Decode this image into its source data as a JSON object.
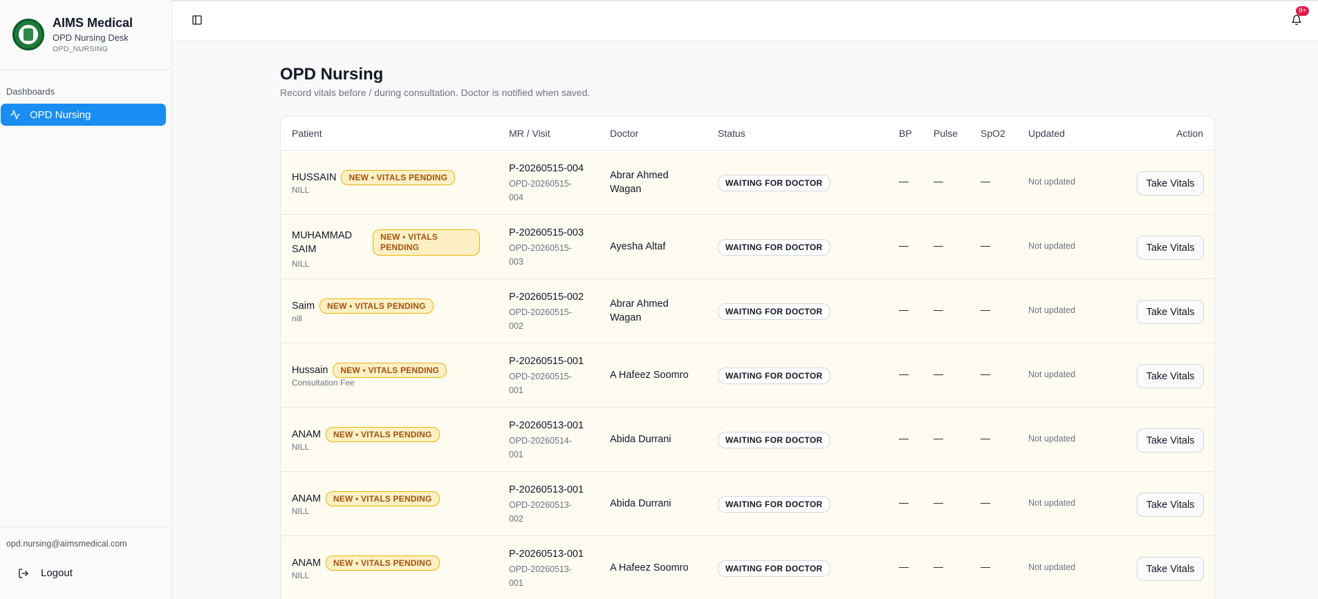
{
  "brand": {
    "title": "AIMS Medical",
    "subtitle": "OPD Nursing Desk",
    "role": "OPD_NURSING"
  },
  "sidebar": {
    "section_label": "Dashboards",
    "items": [
      {
        "label": "OPD Nursing",
        "icon": "activity-icon",
        "active": true
      }
    ],
    "user_email": "opd.nursing@aimsmedical.com",
    "logout_label": "Logout"
  },
  "topbar": {
    "notification_badge": "9+"
  },
  "page": {
    "title": "OPD Nursing",
    "description": "Record vitals before / during consultation. Doctor is notified when saved."
  },
  "table": {
    "headers": {
      "patient": "Patient",
      "mr_visit": "MR / Visit",
      "doctor": "Doctor",
      "status": "Status",
      "bp": "BP",
      "pulse": "Pulse",
      "spo2": "SpO2",
      "updated": "Updated",
      "action": "Action"
    },
    "rows": [
      {
        "name": "HUSSAIN",
        "badge": "NEW • VITALS PENDING",
        "note": "NILL",
        "mr": "P-20260515-004",
        "visit": "OPD-20260515-004",
        "doctor": "Abrar Ahmed Wagan",
        "status": "WAITING FOR DOCTOR",
        "bp": "—",
        "pulse": "—",
        "spo2": "—",
        "updated": "Not updated",
        "action": "Take Vitals"
      },
      {
        "name": "MUHAMMAD SAIM",
        "badge": "NEW • VITALS PENDING",
        "note": "NILL",
        "mr": "P-20260515-003",
        "visit": "OPD-20260515-003",
        "doctor": "Ayesha Altaf",
        "status": "WAITING FOR DOCTOR",
        "bp": "—",
        "pulse": "—",
        "spo2": "—",
        "updated": "Not updated",
        "action": "Take Vitals"
      },
      {
        "name": "Saim",
        "badge": "NEW • VITALS PENDING",
        "note": "nill",
        "mr": "P-20260515-002",
        "visit": "OPD-20260515-002",
        "doctor": "Abrar Ahmed Wagan",
        "status": "WAITING FOR DOCTOR",
        "bp": "—",
        "pulse": "—",
        "spo2": "—",
        "updated": "Not updated",
        "action": "Take Vitals"
      },
      {
        "name": "Hussain",
        "badge": "NEW • VITALS PENDING",
        "note": "Consultation Fee",
        "mr": "P-20260515-001",
        "visit": "OPD-20260515-001",
        "doctor": "A Hafeez Soomro",
        "status": "WAITING FOR DOCTOR",
        "bp": "—",
        "pulse": "—",
        "spo2": "—",
        "updated": "Not updated",
        "action": "Take Vitals"
      },
      {
        "name": "ANAM",
        "badge": "NEW • VITALS PENDING",
        "note": "NILL",
        "mr": "P-20260513-001",
        "visit": "OPD-20260514-001",
        "doctor": "Abida Durrani",
        "status": "WAITING FOR DOCTOR",
        "bp": "—",
        "pulse": "—",
        "spo2": "—",
        "updated": "Not updated",
        "action": "Take Vitals"
      },
      {
        "name": "ANAM",
        "badge": "NEW • VITALS PENDING",
        "note": "NILL",
        "mr": "P-20260513-001",
        "visit": "OPD-20260513-002",
        "doctor": "Abida Durrani",
        "status": "WAITING FOR DOCTOR",
        "bp": "—",
        "pulse": "—",
        "spo2": "—",
        "updated": "Not updated",
        "action": "Take Vitals"
      },
      {
        "name": "ANAM",
        "badge": "NEW • VITALS PENDING",
        "note": "NILL",
        "mr": "P-20260513-001",
        "visit": "OPD-20260513-001",
        "doctor": "A Hafeez Soomro",
        "status": "WAITING FOR DOCTOR",
        "bp": "—",
        "pulse": "—",
        "spo2": "—",
        "updated": "Not updated",
        "action": "Take Vitals"
      }
    ]
  },
  "colors": {
    "accent": "#1a8df2",
    "row_bg": "#fefbf0",
    "badge_bg": "#fdf0c4",
    "badge_text": "#a35210",
    "notification": "#e11d48"
  }
}
